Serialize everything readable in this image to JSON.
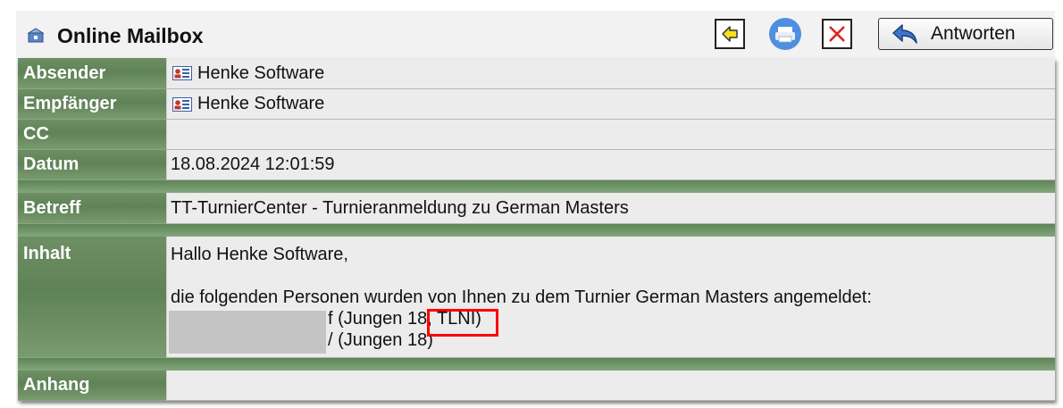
{
  "header": {
    "title": "Online Mailbox",
    "reply_label": "Antworten"
  },
  "fields": {
    "sender_label": "Absender",
    "sender_value": "Henke Software",
    "recipient_label": "Empfänger",
    "recipient_value": "Henke Software",
    "cc_label": "CC",
    "cc_value": "",
    "date_label": "Datum",
    "date_value": "18.08.2024 12:01:59",
    "subject_label": "Betreff",
    "subject_value": "TT-TurnierCenter - Turnieranmeldung zu German Masters",
    "content_label": "Inhalt",
    "attachment_label": "Anhang",
    "attachment_value": ""
  },
  "content": {
    "greeting": "Hallo Henke Software,",
    "body": "die folgenden Personen wurden von Ihnen zu dem Turnier German Masters angemeldet:",
    "persons": [
      "f (Jungen 18, TLNI)",
      "/ (Jungen 18)"
    ]
  },
  "colors": {
    "label_green": "#5f8256",
    "highlight_red": "#ff0000"
  },
  "icons": [
    "mailbox-icon",
    "arrow-left-icon",
    "printer-icon",
    "close-icon",
    "reply-arrow-icon",
    "contact-card-icon"
  ]
}
